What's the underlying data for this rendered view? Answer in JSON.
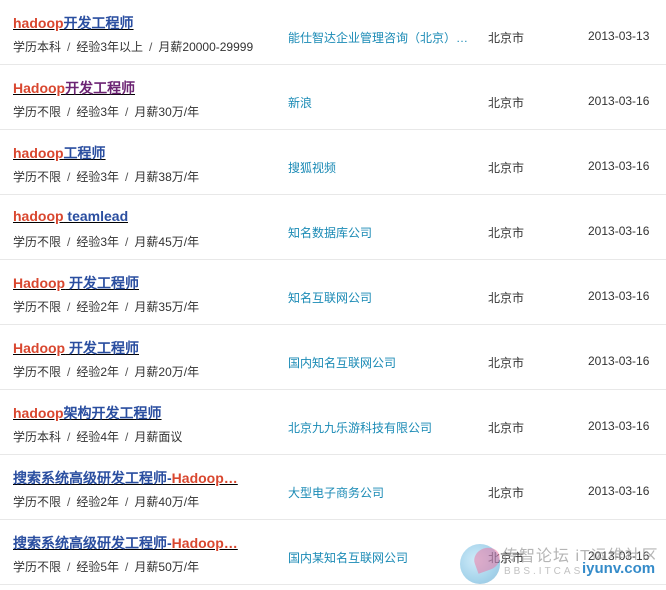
{
  "jobs": [
    {
      "keyword": "hadoop",
      "rest": "开发工程师",
      "education": "学历本科",
      "experience": "经验3年以上",
      "salary": "月薪20000-29999",
      "company": "能仕智达企业管理咨询（北京）…",
      "city": "北京市",
      "date": "2013-03-13",
      "visited": false
    },
    {
      "keyword": "Hadoop",
      "rest": "开发工程师",
      "education": "学历不限",
      "experience": "经验3年",
      "salary": "月薪30万/年",
      "company": "新浪",
      "city": "北京市",
      "date": "2013-03-16",
      "visited": true
    },
    {
      "keyword": "hadoop",
      "rest": "工程师",
      "education": "学历不限",
      "experience": "经验3年",
      "salary": "月薪38万/年",
      "company": "搜狐视频",
      "city": "北京市",
      "date": "2013-03-16",
      "visited": false
    },
    {
      "keyword": "hadoop",
      "rest": " teamlead",
      "education": "学历不限",
      "experience": "经验3年",
      "salary": "月薪45万/年",
      "company": "知名数据库公司",
      "city": "北京市",
      "date": "2013-03-16",
      "visited": false
    },
    {
      "keyword": "Hadoop",
      "rest": " 开发工程师",
      "education": "学历不限",
      "experience": "经验2年",
      "salary": "月薪35万/年",
      "company": "知名互联网公司",
      "city": "北京市",
      "date": "2013-03-16",
      "visited": false
    },
    {
      "keyword": "Hadoop",
      "rest": " 开发工程师",
      "education": "学历不限",
      "experience": "经验2年",
      "salary": "月薪20万/年",
      "company": "国内知名互联网公司",
      "city": "北京市",
      "date": "2013-03-16",
      "visited": false
    },
    {
      "keyword": "hadoop",
      "rest": "架构开发工程师",
      "education": "学历本科",
      "experience": "经验4年",
      "salary": "月薪面议",
      "company": "北京九九乐游科技有限公司",
      "city": "北京市",
      "date": "2013-03-16",
      "visited": false
    },
    {
      "prefix": "搜索系统高级研发工程师-",
      "keyword": "Hadoop…",
      "rest": "",
      "education": "学历不限",
      "experience": "经验2年",
      "salary": "月薪40万/年",
      "company": "大型电子商务公司",
      "city": "北京市",
      "date": "2013-03-16",
      "visited": false
    },
    {
      "prefix": "搜索系统高级研发工程师-",
      "keyword": "Hadoop…",
      "rest": "",
      "education": "学历不限",
      "experience": "经验5年",
      "salary": "月薪50万/年",
      "company": "国内某知名互联网公司",
      "city": "北京市",
      "date": "2013-03-16",
      "visited": false
    }
  ],
  "separator": "/",
  "watermark": {
    "cn": "传智论坛 iT运维社区",
    "en": "BBS.ITCAST.CN",
    "brand": "iyunv.com"
  },
  "colors": {
    "keyword": "#d9472f",
    "link": "#2a4ea0",
    "visited": "#6c2473",
    "company": "#1a8ab5"
  }
}
